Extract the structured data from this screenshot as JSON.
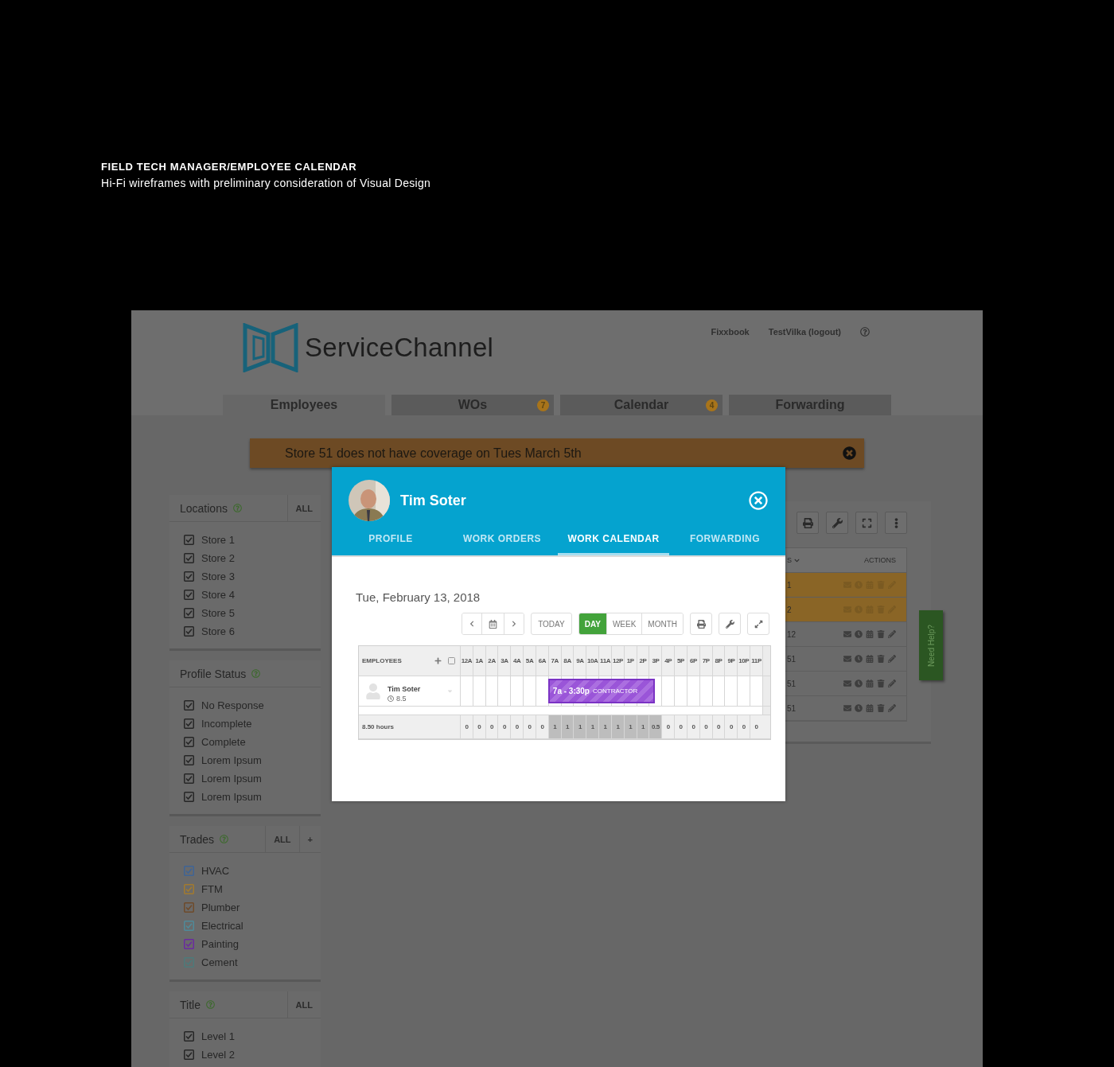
{
  "slide": {
    "title": "FIELD TECH MANAGER/EMPLOYEE CALENDAR",
    "subtitle": "Hi-Fi wireframes with preliminary consideration of Visual Design"
  },
  "header": {
    "logo": "ServiceChannel",
    "links": [
      "Fixxbook",
      "TestVilka (logout)"
    ]
  },
  "nav_tabs": [
    {
      "label": "Employees",
      "selected": true
    },
    {
      "label": "WOs",
      "badge": "7",
      "selected": false
    },
    {
      "label": "Calendar",
      "badge": "4",
      "selected": false
    },
    {
      "label": "Forwarding",
      "selected": false
    }
  ],
  "alert": {
    "message": "Store 51 does not have coverage on Tues March 5th"
  },
  "filters": [
    {
      "title": "Locations",
      "actions": [
        "ALL"
      ],
      "items": [
        {
          "label": "Store 1",
          "checked": true
        },
        {
          "label": "Store 2",
          "checked": true
        },
        {
          "label": "Store 3",
          "checked": true
        },
        {
          "label": "Store 4",
          "checked": true
        },
        {
          "label": "Store 5",
          "checked": true
        },
        {
          "label": "Store 6",
          "checked": true
        }
      ]
    },
    {
      "title": "Profile Status",
      "items": [
        {
          "label": "No Response",
          "checked": true
        },
        {
          "label": "Incomplete",
          "checked": true
        },
        {
          "label": "Complete",
          "checked": true
        },
        {
          "label": "Lorem Ipsum",
          "checked": true
        },
        {
          "label": "Lorem Ipsum",
          "checked": true
        },
        {
          "label": "Lorem Ipsum",
          "checked": true
        }
      ]
    },
    {
      "title": "Trades",
      "actions": [
        "ALL",
        "+"
      ],
      "items": [
        {
          "label": "HVAC",
          "checked": true,
          "color": "#3f6496"
        },
        {
          "label": "FTM",
          "checked": true,
          "color": "#a27a2e"
        },
        {
          "label": "Plumber",
          "checked": true,
          "color": "#6e4a2a"
        },
        {
          "label": "Electrical",
          "checked": true,
          "color": "#4f8a99"
        },
        {
          "label": "Painting",
          "checked": true,
          "color": "#6a2aa0"
        },
        {
          "label": "Cement",
          "checked": true,
          "color": "#4d7a7a"
        }
      ]
    },
    {
      "title": "Title",
      "actions": [
        "ALL"
      ],
      "items": [
        {
          "label": "Level 1",
          "checked": true
        },
        {
          "label": "Level 2",
          "checked": true
        }
      ]
    }
  ],
  "table": {
    "columns": [
      "S",
      "ACTIONS"
    ],
    "rows": [
      {
        "column_1": "1",
        "highlighted": true
      },
      {
        "column_1": "2",
        "highlighted": true
      },
      {
        "column_1": "12",
        "highlighted": false
      },
      {
        "column_1": "51",
        "highlighted": false
      },
      {
        "column_1": "51",
        "highlighted": false
      },
      {
        "column_1": "51",
        "highlighted": false
      }
    ]
  },
  "help_tab": "Need Help?",
  "modal": {
    "name": "Tim Soter",
    "tabs": [
      {
        "label": "PROFILE",
        "selected": false
      },
      {
        "label": "WORK ORDERS",
        "selected": false
      },
      {
        "label": "WORK CALENDAR",
        "selected": true
      },
      {
        "label": "FORWARDING",
        "selected": false
      }
    ],
    "date": "Tue, February 13, 2018",
    "today": "TODAY",
    "views": [
      {
        "label": "DAY",
        "selected": true
      },
      {
        "label": "WEEK",
        "selected": false
      },
      {
        "label": "MONTH",
        "selected": false
      }
    ],
    "grid": {
      "header": "EMPLOYEES",
      "select_all": {
        "checked": false
      },
      "employee": {
        "name": "Tim Soter",
        "hours": "8.5"
      },
      "event": {
        "time": "7a - 3:30p",
        "label": "CONTRACTOR"
      },
      "total_label": "8.50 hours",
      "hours": [
        {
          "label": "12A",
          "total": "0",
          "kind": "free"
        },
        {
          "label": "1A",
          "total": "0",
          "kind": "free"
        },
        {
          "label": "2A",
          "total": "0",
          "kind": "free"
        },
        {
          "label": "3A",
          "total": "0",
          "kind": "free"
        },
        {
          "label": "4A",
          "total": "0",
          "kind": "free"
        },
        {
          "label": "5A",
          "total": "0",
          "kind": "free"
        },
        {
          "label": "6A",
          "total": "0",
          "kind": "free"
        },
        {
          "label": "7A",
          "total": "1",
          "kind": "booked"
        },
        {
          "label": "8A",
          "total": "1",
          "kind": "booked"
        },
        {
          "label": "9A",
          "total": "1",
          "kind": "booked"
        },
        {
          "label": "10A",
          "total": "1",
          "kind": "booked"
        },
        {
          "label": "11A",
          "total": "1",
          "kind": "booked"
        },
        {
          "label": "12P",
          "total": "1",
          "kind": "booked"
        },
        {
          "label": "1P",
          "total": "1",
          "kind": "booked"
        },
        {
          "label": "2P",
          "total": "1",
          "kind": "booked"
        },
        {
          "label": "3P",
          "total": "0.5",
          "kind": "partial"
        },
        {
          "label": "4P",
          "total": "0",
          "kind": "free"
        },
        {
          "label": "5P",
          "total": "0",
          "kind": "free"
        },
        {
          "label": "6P",
          "total": "0",
          "kind": "free"
        },
        {
          "label": "7P",
          "total": "0",
          "kind": "free"
        },
        {
          "label": "8P",
          "total": "0",
          "kind": "free"
        },
        {
          "label": "9P",
          "total": "0",
          "kind": "free"
        },
        {
          "label": "10P",
          "total": "0",
          "kind": "free"
        },
        {
          "label": "11P",
          "total": "0",
          "kind": "free"
        }
      ]
    }
  }
}
